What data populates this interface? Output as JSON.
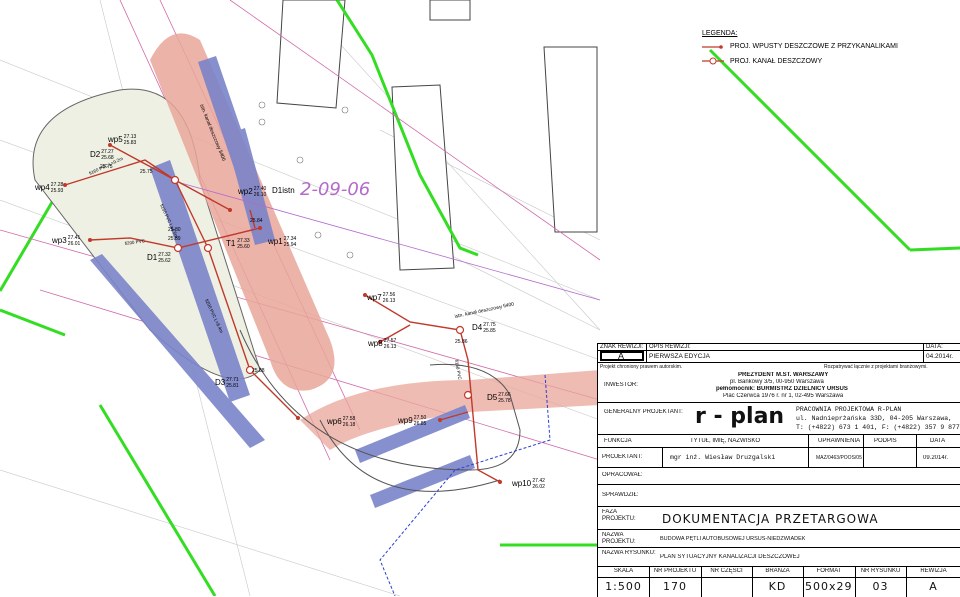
{
  "legend": {
    "title": "LEGENDA:",
    "items": [
      {
        "label": "PROJ. WPUSTY DESZCZOWE Z PRZYKANALIKAMI",
        "color": "#c0392b",
        "marker": "line-dot"
      },
      {
        "label": "PROJ. KANAŁ DESZCZOWY",
        "color": "#c0392b",
        "marker": "line-circle"
      }
    ]
  },
  "map_labels": {
    "date_watermark": "2-09-06",
    "canal_label_1": "istn. kanał deszczowy fi400",
    "canal_label_2": "istn. kanał deszczowy fi400",
    "istn": "D1istn",
    "nodes": [
      {
        "id": "wp5",
        "top": "27.13",
        "bot": "25.83"
      },
      {
        "id": "D2",
        "top": "27.27",
        "bot": "25.68"
      },
      {
        "id": "wp4",
        "top": "27.28",
        "bot": "25.93"
      },
      {
        "id": "wp3",
        "top": "27.41",
        "bot": "26.01"
      },
      {
        "id": "D1",
        "top": "27.32",
        "bot": "25.62"
      },
      {
        "id": "wp2",
        "top": "27.40",
        "bot": "26.10"
      },
      {
        "id": "T1",
        "top": "27.33",
        "bot": "25.60"
      },
      {
        "id": "wp1",
        "top": "27.34",
        "bot": "25.94"
      },
      {
        "id": "wp7",
        "top": "27.56",
        "bot": "26.13"
      },
      {
        "id": "D4",
        "top": "27.75",
        "bot": "25.85"
      },
      {
        "id": "wp8",
        "top": "27.57",
        "bot": "26.13"
      },
      {
        "id": "D3",
        "top": "27.71",
        "bot": "25.81"
      },
      {
        "id": "wp6",
        "top": "27.58",
        "bot": "26.18"
      },
      {
        "id": "wp9",
        "top": "27.50",
        "bot": "26.85"
      },
      {
        "id": "D5",
        "top": "27.66",
        "bot": "25.78"
      },
      {
        "id": "wp10",
        "top": "27.42",
        "bot": "26.02"
      }
    ],
    "misc_values": [
      "25.75",
      "25.75",
      "25.89",
      "25.80",
      "25.84",
      "25.88",
      "25.86"
    ],
    "pipe_labels": [
      "fi160 PVC L=9.2m",
      "fi200 PVC",
      "fi160 PVC L=4.5m",
      "fi200 PVC L=8.4m",
      "fi160 PVC"
    ]
  },
  "revision": {
    "h_znak": "ZNAK REWIZJI:",
    "h_opis": "OPIS REWIZJI:",
    "h_data": "DATA:",
    "znak": "A",
    "opis": "PIERWSZA EDYCJA",
    "data": "04.2014r."
  },
  "rights_note": "Projekt chroniony prawem autorskim.",
  "coord_note": "Rozpatrywać łącznie z projektami branżowymi.",
  "investor": {
    "label": "INWESTOR:",
    "name": "PREZYDENT M.ST. WARSZAWY",
    "addr": "pl. Bankowy 3/5, 00-950 Warszawa",
    "rep": "pełnomocnik: BURMISTRZ DZIELNICY URSUS",
    "addr2": "Plac Czerwca 1976 r. nr 1, 02-495 Warszawa"
  },
  "designer": {
    "label": "GENERALNY PROJEKTANT:",
    "logo": "r - plan",
    "firm": "PRACOWNIA PROJEKTOWA R-PLAN",
    "addr": "ul. Nadnieprżańska 33D, 04-205 Warszawa,",
    "phone": "T: (+4822) 673 1 401, F: (+4822) 357 9 877"
  },
  "team": {
    "h_funkcja": "FUNKCJA",
    "h_tytul": "TYTUŁ, IMIĘ, NAZWISKO",
    "h_upr": "UPRAWNIENIA",
    "h_podpis": "PODPIS",
    "h_data": "DATA",
    "projektant_label": "PROJEKTANT:",
    "projektant_name": "mgr inż. Wiesław Druzgalski",
    "projektant_upr": "MAZ/0463/POOS/05",
    "projektant_data": "09.2014r.",
    "opracowal": "OPRACOWAŁ:",
    "sprawdzil": "SPRAWDZIŁ:"
  },
  "project": {
    "faza_label": "FAZA PROJEKTU:",
    "faza": "DOKUMENTACJA PRZETARGOWA",
    "nazwa_label": "NAZWA PROJEKTU:",
    "nazwa": "BUDOWA PĘTLI AUTOBUSOWEJ URSUS-NIEDŹWIADEK",
    "rys_label": "NAZWA RYSUNKU:",
    "rys": "PLAN SYTUACYJNY KANALIZACJI DESZCZOWEJ"
  },
  "footer": {
    "headers": [
      "SKALA",
      "NR PROJEKTU",
      "NR CZĘŚCI",
      "BRANŻA",
      "FORMAT",
      "NR RYSUNKU",
      "REWIZJA"
    ],
    "values": [
      "1:500",
      "170",
      "",
      "KD",
      "500x297",
      "03",
      "A"
    ]
  },
  "colors": {
    "sewer": "#c0392b",
    "boundary": "#33dd22",
    "parking": "#7b84c9",
    "asphalt": "#e9a69a",
    "blue_line": "#2a3fd1"
  }
}
